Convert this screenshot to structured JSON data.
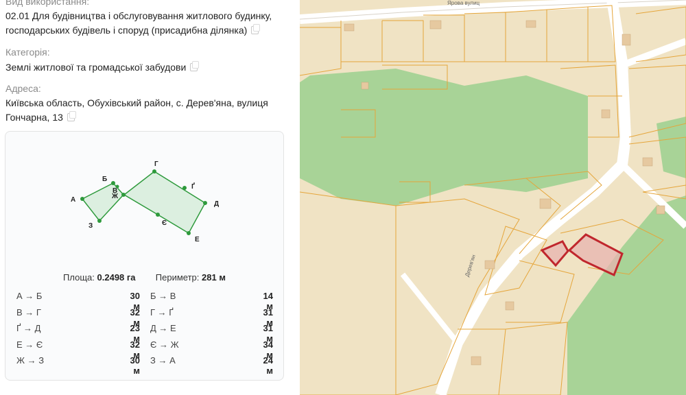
{
  "info": {
    "usage_label": "Вид використання:",
    "usage_value_line1": "02.01 Для будівництва і обслуговування житлового будинку,",
    "usage_value_line2": "господарських будівель і споруд (присадибна ділянка)",
    "category_label": "Категорія:",
    "category_value": "Землі житлової та громадської забудови",
    "address_label": "Адреса:",
    "address_line1": "Київська область, Обухівський район, с. Дерев'яна, вулиця",
    "address_line2": "Гончарна, 13"
  },
  "shape": {
    "vertices": [
      "А",
      "Б",
      "В",
      "Ж",
      "Г",
      "Ґ",
      "Д",
      "Е",
      "Є",
      "З"
    ]
  },
  "stats": {
    "area_label": "Площа:",
    "area_value": "0.2498 га",
    "perimeter_label": "Периметр:",
    "perimeter_value": "281 м"
  },
  "segments": [
    {
      "a": "А → Б",
      "av": "30 м",
      "b": "Б → В",
      "bv": "14 м"
    },
    {
      "a": "В → Г",
      "av": "32 м",
      "b": "Г → Ґ",
      "bv": "31 м"
    },
    {
      "a": "Ґ → Д",
      "av": "23 м",
      "b": "Д → Е",
      "bv": "31 м"
    },
    {
      "a": "Е → Є",
      "av": "32 м",
      "b": "Є → Ж",
      "bv": "34 м"
    },
    {
      "a": "Ж → З",
      "av": "30 м",
      "b": "З → А",
      "bv": "24 м"
    }
  ],
  "map": {
    "street_top": "Ярова вулиц",
    "street_vertical": "Дерев'ян",
    "colors": {
      "parcel_fill": "#f0e3c4",
      "parcel_line": "#e5a53a",
      "forest": "#9bd08f",
      "road": "#ffffff",
      "highlight": "#c0272d"
    }
  }
}
